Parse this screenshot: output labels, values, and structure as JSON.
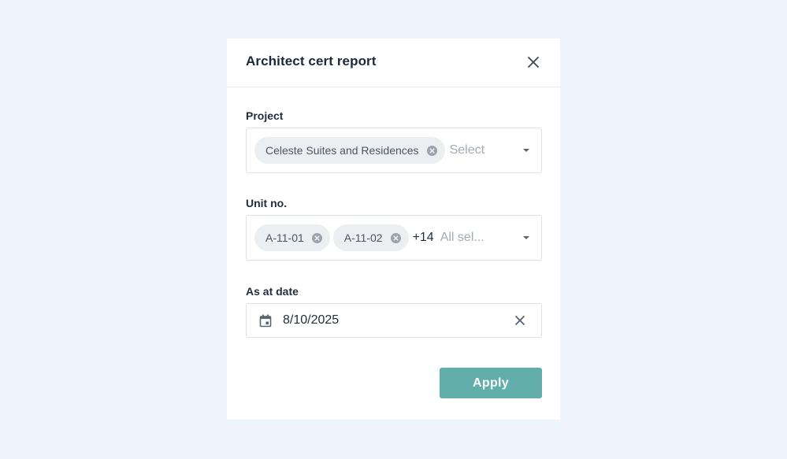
{
  "modal": {
    "title": "Architect cert report",
    "close_icon": "close-icon"
  },
  "project": {
    "label": "Project",
    "chips": [
      "Celeste Suites and Residences"
    ],
    "placeholder": "Select",
    "chip_remove_icon": "close-circle-icon",
    "dropdown_icon": "caret-down-icon"
  },
  "unit": {
    "label": "Unit no.",
    "chips": [
      "A-11-01",
      "A-11-02"
    ],
    "more_count": "+14",
    "placeholder": "All sel...",
    "chip_remove_icon": "close-circle-icon",
    "dropdown_icon": "caret-down-icon"
  },
  "as_at_date": {
    "label": "As at date",
    "value": "8/10/2025",
    "calendar_icon": "calendar-icon",
    "clear_icon": "close-icon"
  },
  "actions": {
    "apply_label": "Apply"
  },
  "colors": {
    "page_background": "#edf4fc",
    "modal_background": "#ffffff",
    "accent": "#62aeab",
    "chip_background": "#eceff2",
    "placeholder": "#a3abb5"
  }
}
